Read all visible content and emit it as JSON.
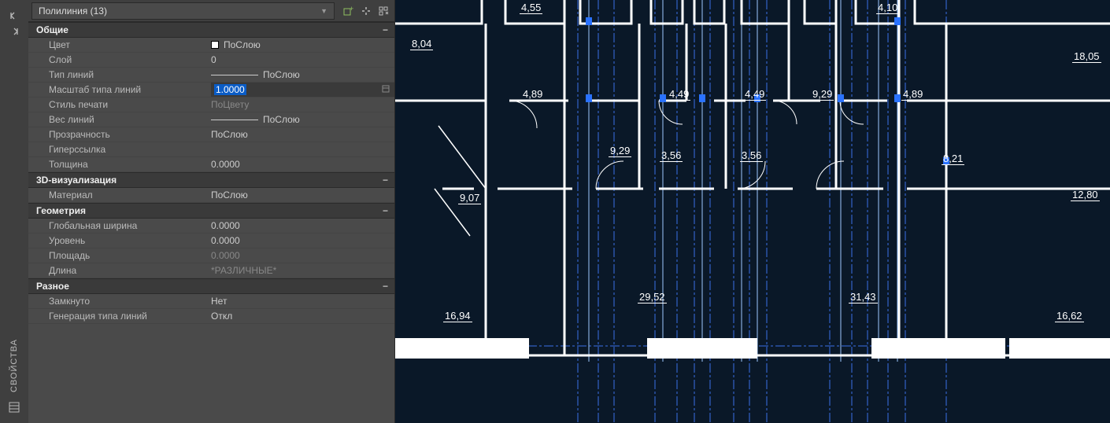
{
  "sidebar": {
    "title": "СВОЙСТВА"
  },
  "palette": {
    "selector": "Полилиния (13)",
    "sections": {
      "general": {
        "title": "Общие",
        "color_label": "Цвет",
        "color_value": "ПоСлою",
        "layer_label": "Слой",
        "layer_value": "0",
        "ltype_label": "Тип линий",
        "ltype_value": "ПоСлою",
        "ltscale_label": "Масштаб типа линий",
        "ltscale_value": "1.0000",
        "pstyle_label": "Стиль печати",
        "pstyle_value": "ПоЦвету",
        "lw_label": "Вес линий",
        "lw_value": "ПоСлою",
        "transp_label": "Прозрачность",
        "transp_value": "ПоСлою",
        "hyper_label": "Гиперссылка",
        "hyper_value": "",
        "thick_label": "Толщина",
        "thick_value": "0.0000"
      },
      "vis3d": {
        "title": "3D-визуализация",
        "material_label": "Материал",
        "material_value": "ПоСлою"
      },
      "geometry": {
        "title": "Геометрия",
        "gwidth_label": "Глобальная ширина",
        "gwidth_value": "0.0000",
        "elev_label": "Уровень",
        "elev_value": "0.0000",
        "area_label": "Площадь",
        "area_value": "0.0000",
        "len_label": "Длина",
        "len_value": "*РАЗЛИЧНЫЕ*"
      },
      "misc": {
        "title": "Разное",
        "closed_label": "Замкнуто",
        "closed_value": "Нет",
        "ltgen_label": "Генерация типа линий",
        "ltgen_value": "Откл"
      }
    }
  },
  "dims": {
    "d0": "4,55",
    "d1": "4,10",
    "d2": "8,04",
    "d3": "18,05",
    "d4": "4,89",
    "d5": "4,49",
    "d6": "4,49",
    "d7": "9,29",
    "d8": "4,89",
    "d9": "9,29",
    "d10": "3,56",
    "d11": "3,56",
    "d12_1": "8,21",
    "d12": "9,07",
    "d13": "12,80",
    "d14": "16,94",
    "d15": "29,52",
    "d16": "31,43",
    "d17": "16,62"
  }
}
